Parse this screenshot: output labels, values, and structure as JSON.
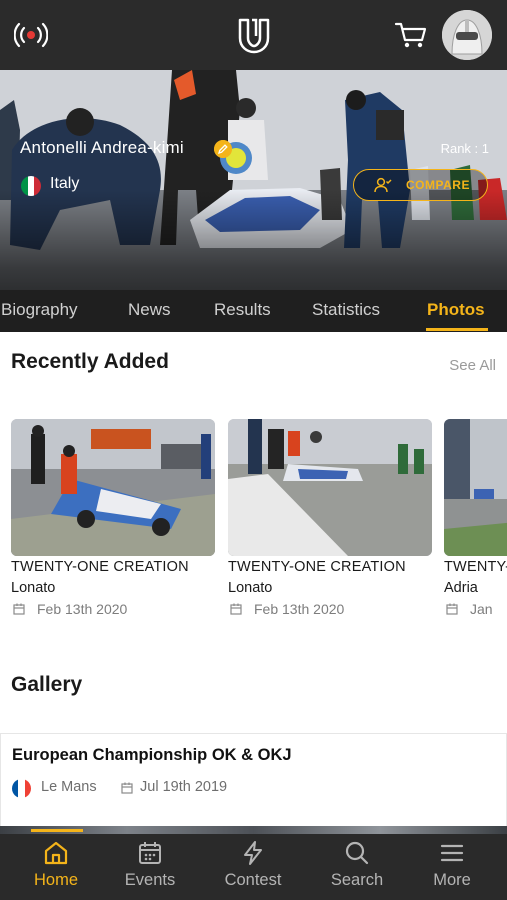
{
  "header": {
    "live_icon": "broadcast-icon",
    "logo_icon": "u-logo-icon",
    "cart_icon": "cart-icon",
    "avatar_icon": "helmet-avatar"
  },
  "profile": {
    "name": "Antonelli Andrea-kimi",
    "verified_icon": "pencil-badge-icon",
    "rank": "Rank : 1",
    "country": "Italy",
    "compare_label": "COMPARE"
  },
  "tabs": [
    {
      "label": "Biography",
      "active": false
    },
    {
      "label": "News",
      "active": false
    },
    {
      "label": "Results",
      "active": false
    },
    {
      "label": "Statistics",
      "active": false
    },
    {
      "label": "Photos",
      "active": true
    }
  ],
  "recently_added": {
    "title": "Recently Added",
    "see_all": "See All",
    "items": [
      {
        "title": "TWENTY-ONE CREATION",
        "location": "Lonato",
        "date": "Feb 13th 2020"
      },
      {
        "title": "TWENTY-ONE CREATION",
        "location": "Lonato",
        "date": "Feb 13th 2020"
      },
      {
        "title": "TWENTY-ONE CREATION",
        "location": "Adria",
        "date": "Jan"
      }
    ]
  },
  "gallery": {
    "title": "Gallery",
    "card": {
      "title": "European Championship OK & OKJ",
      "location": "Le Mans",
      "date": "Jul 19th 2019"
    }
  },
  "bottom_nav": [
    {
      "label": "Home",
      "icon": "home-icon",
      "active": true
    },
    {
      "label": "Events",
      "icon": "calendar-icon",
      "active": false
    },
    {
      "label": "Contest",
      "icon": "lightning-icon",
      "active": false
    },
    {
      "label": "Search",
      "icon": "search-icon",
      "active": false
    },
    {
      "label": "More",
      "icon": "menu-icon",
      "active": false
    }
  ],
  "colors": {
    "accent": "#f4b41a",
    "dark_bar": "#2b2b2b",
    "live_red": "#e53935"
  }
}
